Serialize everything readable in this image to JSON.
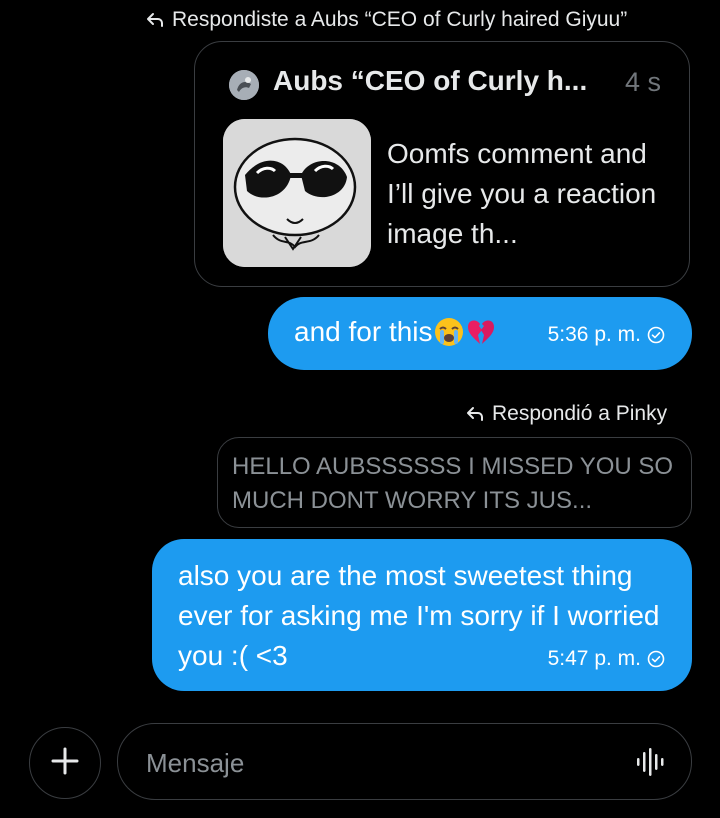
{
  "reply1": {
    "label": "Respondiste a Aubs “CEO of Curly haired Giyuu”"
  },
  "quoted_post": {
    "author": "Aubs “CEO of Curly h...",
    "time": "4 s",
    "text": "Oomfs comment and I’ll give you a reaction image th...",
    "avatar_icon": "avatar",
    "thumbnail": "cartoon-sunglasses-face"
  },
  "message1": {
    "text": "and for this",
    "emojis": [
      "loudly-crying-face-emoji",
      "broken-heart-emoji"
    ],
    "time": "5:36 p. m."
  },
  "reply2": {
    "label": "Respondió a Pinky",
    "quoted_text": "HELLO AUBSSSSSS I MISSED YOU SO MUCH DONT WORRY ITS JUS..."
  },
  "message2": {
    "text": "also you are the most sweetest thing ever for asking me I'm sorry if I worried you :( <3",
    "time": "5:47 p. m."
  },
  "composer": {
    "placeholder": "Mensaje",
    "value": ""
  },
  "colors": {
    "background": "#000000",
    "bubble": "#1d9bf0",
    "border": "#3a3d41",
    "muted_text": "#71767b"
  }
}
